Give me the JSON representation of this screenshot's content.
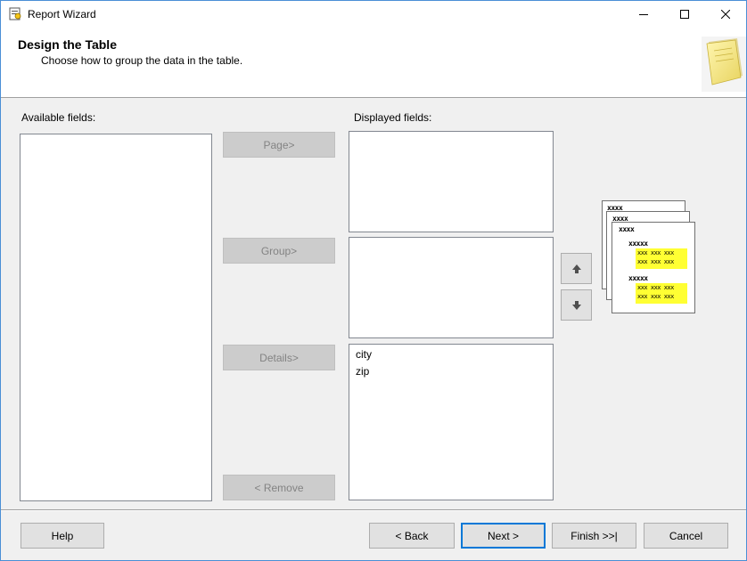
{
  "window": {
    "title": "Report Wizard"
  },
  "header": {
    "title": "Design the Table",
    "subtitle": "Choose how to group the data in the table."
  },
  "available": {
    "label": "Available fields:",
    "items": []
  },
  "displayed": {
    "label": "Displayed fields:",
    "page_items": [],
    "group_items": [],
    "details_items": [
      "city",
      "zip"
    ]
  },
  "buttons": {
    "page": "Page>",
    "group": "Group>",
    "details": "Details>",
    "remove": "< Remove",
    "help": "Help",
    "back": "< Back",
    "next": "Next >",
    "finish": "Finish >>|",
    "cancel": "Cancel"
  },
  "preview": {
    "row1": "xxxx",
    "row2": "xxxx",
    "row3": "xxxx",
    "row4": "xxxxx",
    "cells": "xxx xxx xxx",
    "row5": "xxxxx"
  },
  "colors": {
    "accent": "#0078d7",
    "highlight": "#ffff33"
  }
}
